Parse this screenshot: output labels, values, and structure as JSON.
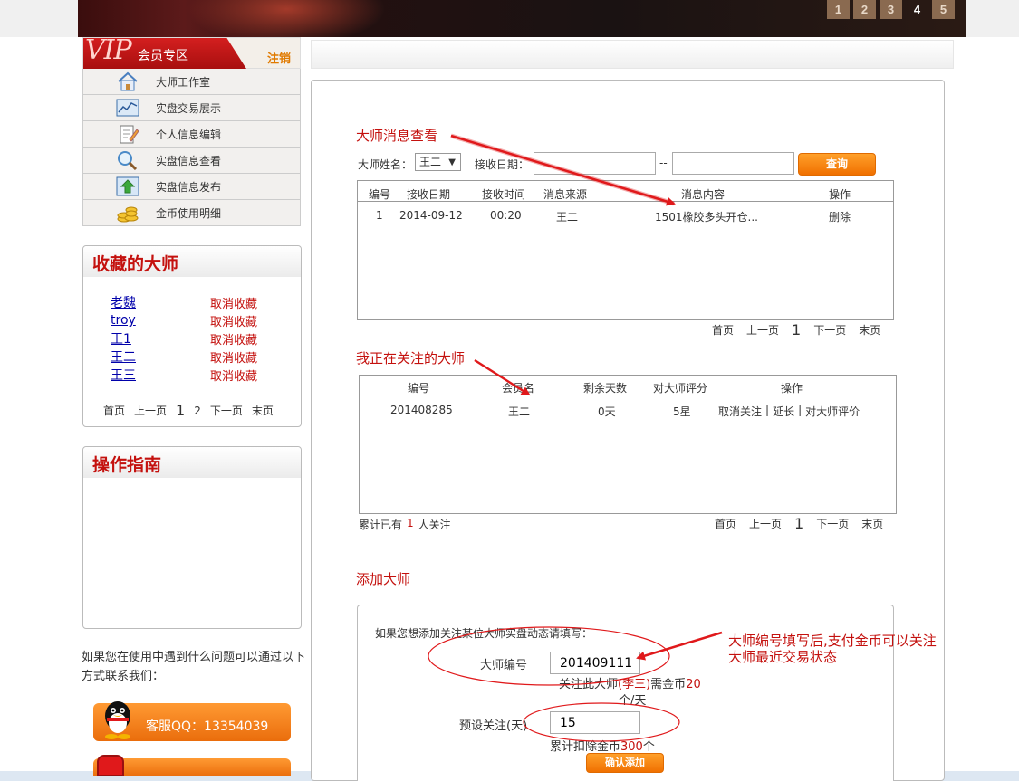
{
  "banner": {
    "pages": [
      "1",
      "2",
      "3",
      "4",
      "5"
    ],
    "active_page": "4"
  },
  "vip": {
    "logo": "VIP",
    "title": "会员专区",
    "logout": "注销"
  },
  "menu": [
    {
      "label": "大师工作室",
      "icon": "house-icon"
    },
    {
      "label": "实盘交易展示",
      "icon": "chart-icon"
    },
    {
      "label": "个人信息编辑",
      "icon": "edit-document-icon"
    },
    {
      "label": "实盘信息查看",
      "icon": "magnifier-icon"
    },
    {
      "label": "实盘信息发布",
      "icon": "upload-arrow-icon"
    },
    {
      "label": "金币使用明细",
      "icon": "gold-coins-icon"
    }
  ],
  "favorites": {
    "title": "收藏的大师",
    "items": [
      {
        "name": "老魏",
        "action": "取消收藏"
      },
      {
        "name": "troy",
        "action": "取消收藏"
      },
      {
        "name": "王1",
        "action": "取消收藏"
      },
      {
        "name": "王二",
        "action": "取消收藏"
      },
      {
        "name": "王三",
        "action": "取消收藏"
      }
    ],
    "pager": {
      "first": "首页",
      "prev": "上一页",
      "current": "1",
      "page2": "2",
      "next": "下一页",
      "last": "末页"
    }
  },
  "guide": {
    "title": "操作指南"
  },
  "contact": {
    "help": "如果您在使用中遇到什么问题可以通过以下方式联系我们：",
    "qq": "客服QQ：13354039"
  },
  "messages": {
    "title": "大师消息查看",
    "name_label": "大师姓名：",
    "name_value": "王二",
    "date_label": "接收日期：",
    "date_sep": "--",
    "query_button": "查询",
    "headers": [
      "编号",
      "接收日期",
      "接收时间",
      "消息来源",
      "消息内容",
      "操作"
    ],
    "rows": [
      {
        "id": "1",
        "date": "2014-09-12",
        "time": "00:20",
        "source": "王二",
        "content": "1501橡胶多头开仓...",
        "action": "删除"
      }
    ],
    "pager": {
      "first": "首页",
      "prev": "上一页",
      "current": "1",
      "next": "下一页",
      "last": "末页"
    }
  },
  "following": {
    "title": "我正在关注的大师",
    "headers": [
      "编号",
      "会员名",
      "剩余天数",
      "对大师评分",
      "操作"
    ],
    "rows": [
      {
        "id": "201408285",
        "name": "王二",
        "days": "0天",
        "rating": "5星",
        "cancel": "取消关注",
        "sep1": "|",
        "extend": "延长",
        "sep2": "|",
        "rate": "对大师评价"
      }
    ],
    "summary_pre": "累计已有",
    "summary_count": "1",
    "summary_post": "人关注",
    "pager": {
      "first": "首页",
      "prev": "上一页",
      "current": "1",
      "next": "下一页",
      "last": "末页"
    }
  },
  "add": {
    "title": "添加大师",
    "intro": "如果您想添加关注某位大师实盘动态请填写：",
    "id_label": "大师编号",
    "id_value": "201409111",
    "cost_pre": "关注此大师",
    "cost_name": "(李三)",
    "cost_mid": "需金币",
    "cost_num": "20",
    "cost_unit": "个/天",
    "days_label": "预设关注(天)",
    "days_value": "15",
    "total_pre": "累计扣除金币",
    "total_num": "300",
    "total_post": "个",
    "confirm_button": "确认添加"
  },
  "annotation": {
    "line1": "大师编号填写后,支付金币可以关注",
    "line2": "大师最近交易状态"
  },
  "colors": {
    "accent_red": "#c4110e",
    "orange": "#f07000",
    "banner": "#241010"
  }
}
